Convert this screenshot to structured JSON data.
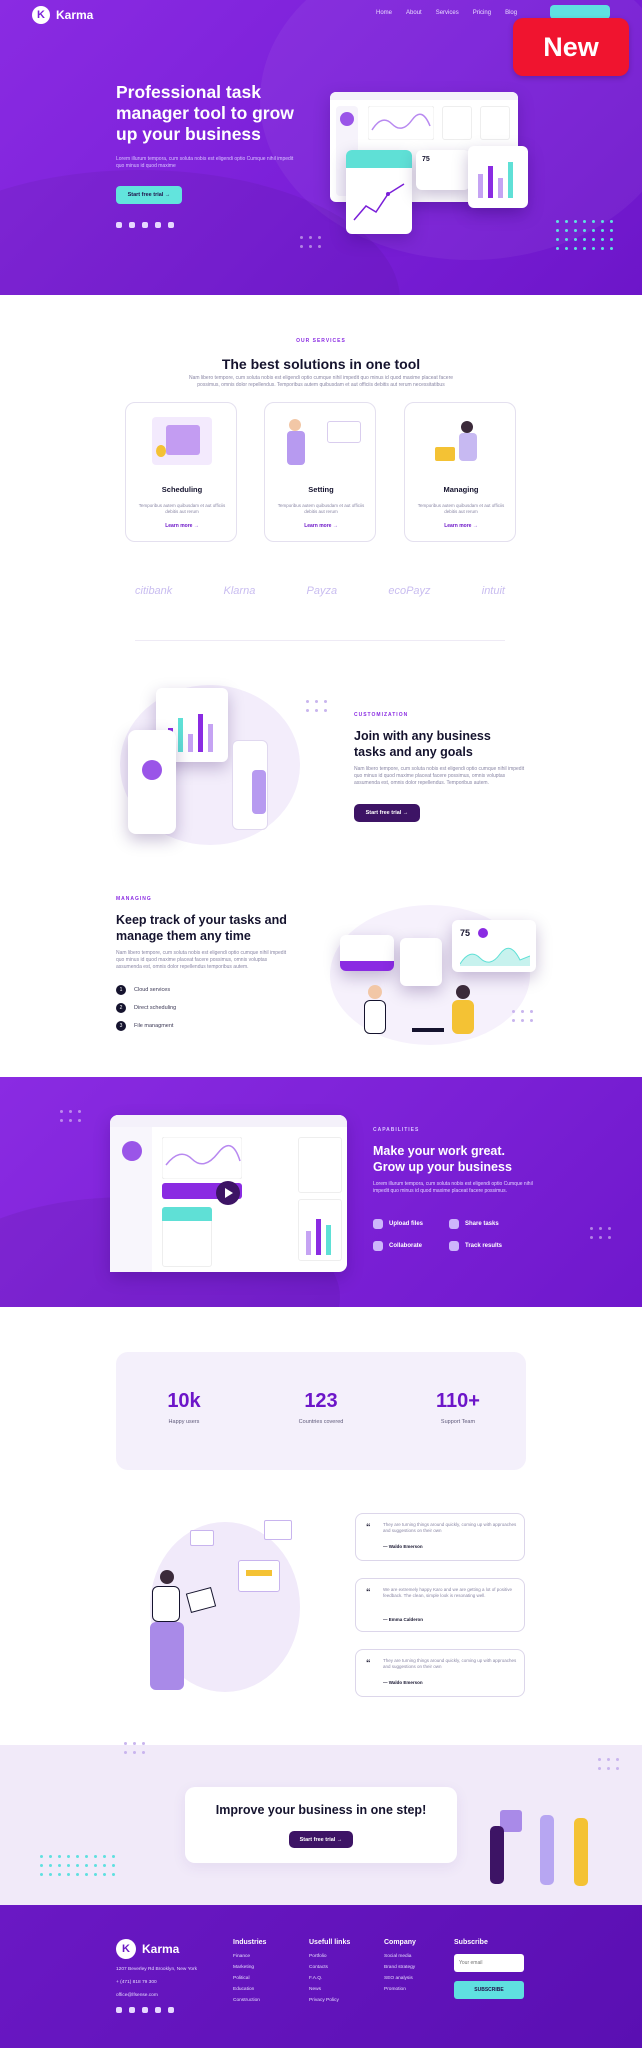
{
  "nav": {
    "brand": "Karma",
    "brand_initial": "K",
    "items": [
      "Home",
      "About",
      "Services",
      "Pricing",
      "Blog"
    ],
    "badge": "New"
  },
  "hero": {
    "title": "Professional task manager tool to grow up your business",
    "subtitle": "Lorem illurum tempora, cum soluta nobis est eligendi optio Cumque nihil impedit quo minus id quod maxime",
    "cta": "Start free trial →",
    "mock_stat": "75"
  },
  "services": {
    "eyebrow": "OUR SERVICES",
    "title": "The best solutions in one tool",
    "subtitle": "Nam libero tempore, cum soluta nobis est eligendi optio cumque nihil impedit quo minus id quod maxime placeat facere possimus, omnis dolor repellendus. Temporibus autem quibusdam et aut officiis debitis aut rerum necessitatibus",
    "cards": [
      {
        "title": "Scheduling",
        "desc": "Temporibus autem quibusdam et aut officiis debitis aut rerum",
        "link": "Learn more →"
      },
      {
        "title": "Setting",
        "desc": "Temporibus autem quibusdam et aut officiis debitis aut rerum",
        "link": "Learn more →"
      },
      {
        "title": "Managing",
        "desc": "Temporibus autem quibusdam et aut officiis debitis aut rerum",
        "link": "Learn more →"
      }
    ],
    "logos": [
      "citibank",
      "Klarna",
      "Payza",
      "ecoPayz",
      "intuit"
    ]
  },
  "customization": {
    "eyebrow": "CUSTOMIZATION",
    "title": "Join with any business tasks and any goals",
    "body": "Nam libero tempore, cum soluta nobis est eligendi optio cumque nihil impedit quo minus id quod maxime placeat facere possimus, omnis voluptas assumenda est, omnis dolor repellendus. Temporibus autem.",
    "cta": "Start free trial →"
  },
  "managing": {
    "eyebrow": "MANAGING",
    "title": "Keep track of your tasks and manage them any time",
    "body": "Nam libero tempore, cum soluta nobis est eligendi optio cumque nihil impedit quo minus id quod maxime placeat facere possimus, omnis voluptas assumenda est, omnis dolor repellendus temporibus autem.",
    "list": [
      {
        "num": "1",
        "label": "Cloud services"
      },
      {
        "num": "2",
        "label": "Direct scheduling"
      },
      {
        "num": "3",
        "label": "File managment"
      }
    ],
    "mock_stat": "75"
  },
  "capabilities": {
    "eyebrow": "CAPABILITIES",
    "title": "Make your work great. Grow up your business",
    "body": "Lorem illurum tempora, cum soluta nobis est eligendi optio Cumque nihil impedit quo minus id quod maxime placeat facere possimus.",
    "features": [
      "Upload files",
      "Share tasks",
      "Collaborate",
      "Track results"
    ]
  },
  "stats": [
    {
      "value": "10k",
      "label": "Happy users"
    },
    {
      "value": "123",
      "label": "Countries covered"
    },
    {
      "value": "110+",
      "label": "Support Team"
    }
  ],
  "testimonials": [
    {
      "text": "They are turning things around quickly, coming up with approaches and suggestions on their own",
      "author": "— Waldo Emerson"
    },
    {
      "text": "We are extremely happy Karo and we are getting a lot of positive feedback. The clean, simple look is resonating well.",
      "author": "— Emma Calderon"
    },
    {
      "text": "They are turning things around quickly, coming up with approaches and suggestions on their own",
      "author": "— Waldo Emerson"
    }
  ],
  "cta": {
    "title": "Improve your business in one step!",
    "button": "Start free trial →"
  },
  "footer": {
    "brand": "Karma",
    "address": "1207 Beverley Rd Brooklyn, New York",
    "phone": "+ (471) 818 79 300",
    "email": "office@lfsense.com",
    "columns": [
      {
        "heading": "Industries",
        "items": [
          "Finance",
          "Marketing",
          "Political",
          "Education",
          "Construction"
        ]
      },
      {
        "heading": "Usefull links",
        "items": [
          "Portfolio",
          "Contacts",
          "F.A.Q.",
          "News",
          "Privacy Policy"
        ]
      },
      {
        "heading": "Company",
        "items": [
          "Social media",
          "Brand strategy",
          "SEO analysis",
          "Promotion"
        ]
      }
    ],
    "subscribe": {
      "heading": "Subscribe",
      "placeholder": "Your email",
      "button": "SUBSCRIBE"
    }
  },
  "colors": {
    "primary": "#7a1fd8",
    "accent": "#5fe0e0",
    "dark": "#3d1465",
    "badge": "#f0142f"
  }
}
